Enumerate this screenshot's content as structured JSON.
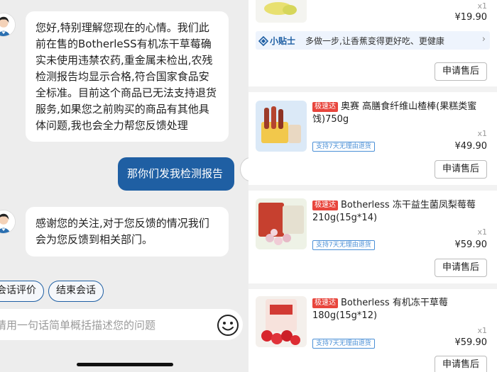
{
  "chat": {
    "messages": [
      {
        "sender": "agent",
        "text": "您好,特别理解您现在的心情。我们此前在售的BotherleSS有机冻干草莓确实未使用违禁农药,重金属未检出,农残检测报告均显示合格,符合国家食品安全标准。目前这个商品已无法支持退货服务,如果您之前购买的商品有其他具体问题,我也会全力帮您反馈处理"
      },
      {
        "sender": "user",
        "text": "那你们发我检测报告"
      },
      {
        "sender": "agent",
        "text": "感谢您的关注,对于您反馈的情况我们会为您反馈到相关部门。"
      }
    ],
    "quick_actions": [
      "会话评价",
      "结束会话"
    ],
    "input_placeholder": "请用一句话简单概括描述您的问题"
  },
  "orders": {
    "top_item": {
      "qty": "x1",
      "price": "¥19.90"
    },
    "tip": {
      "label": "小贴士",
      "text": "多做一步,让香蕉变得更好吃、更健康"
    },
    "after_sale_label": "申请售后",
    "items": [
      {
        "badge": "极速达",
        "title": "奥赛 高膳食纤维山楂棒(果糕类蜜饯)750g",
        "refund_tag": "支持7天无理由退货",
        "qty": "x1",
        "price": "¥49.90"
      },
      {
        "badge": "极速达",
        "title": "Botherless 冻干益生菌凤梨莓莓210g(15g*14)",
        "refund_tag": "支持7天无理由退货",
        "qty": "x1",
        "price": "¥59.90"
      },
      {
        "badge": "极速达",
        "title": "Botherless 有机冻干草莓180g(15g*12)",
        "refund_tag": "支持7天无理由退货",
        "qty": "x1",
        "price": "¥59.90"
      }
    ]
  },
  "colors": {
    "user_bubble": "#1f5fa3",
    "badge": "#e8453c",
    "refund_tag": "#4a8fd6",
    "tip_bg": "#eef4fd"
  },
  "icons": [
    "agent-avatar-icon",
    "emoji-icon",
    "tip-diamond-icon",
    "chevron-right-icon"
  ]
}
